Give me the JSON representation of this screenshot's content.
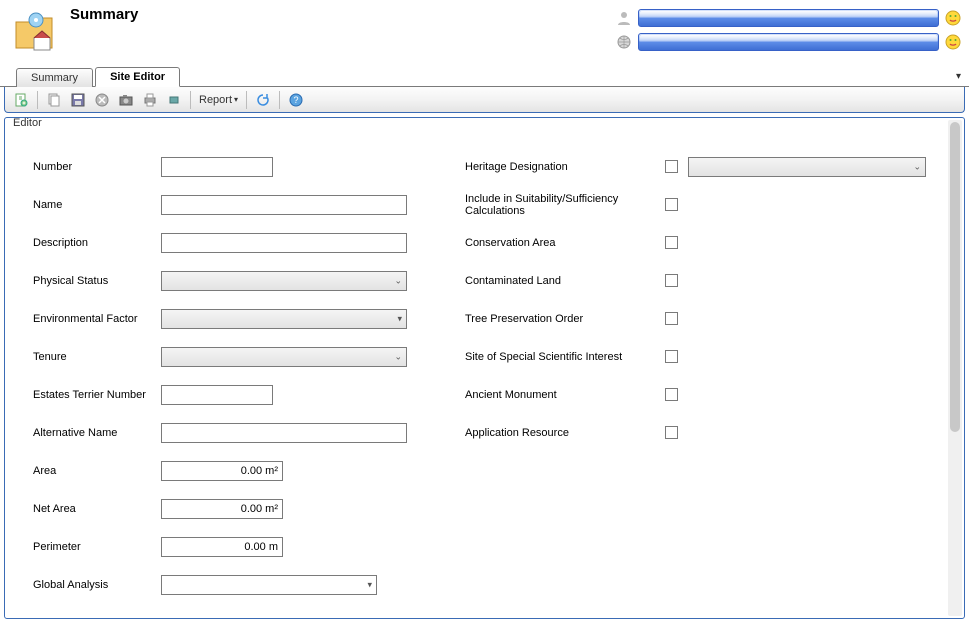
{
  "header": {
    "title": "Summary"
  },
  "tabs": {
    "summary": "Summary",
    "site_editor": "Site Editor"
  },
  "toolbar": {
    "report": "Report"
  },
  "editor": {
    "panel_label": "Editor",
    "left": {
      "number": "Number",
      "name": "Name",
      "description": "Description",
      "physical_status": "Physical Status",
      "environmental_factor": "Environmental Factor",
      "tenure": "Tenure",
      "estates_terrier": "Estates Terrier Number",
      "alternative_name": "Alternative Name",
      "area": "Area",
      "net_area": "Net Area",
      "perimeter": "Perimeter",
      "global_analysis": "Global Analysis"
    },
    "values": {
      "area": "0.00 m²",
      "net_area": "0.00 m²",
      "perimeter": "0.00 m"
    },
    "right": {
      "heritage": "Heritage Designation",
      "include_suitability": "Include in Suitability/Sufficiency Calculations",
      "conservation_area": "Conservation Area",
      "contaminated_land": "Contaminated Land",
      "tree_preservation": "Tree Preservation Order",
      "sssi": "Site of Special Scientific Interest",
      "ancient_monument": "Ancient Monument",
      "application_resource": "Application Resource"
    }
  }
}
